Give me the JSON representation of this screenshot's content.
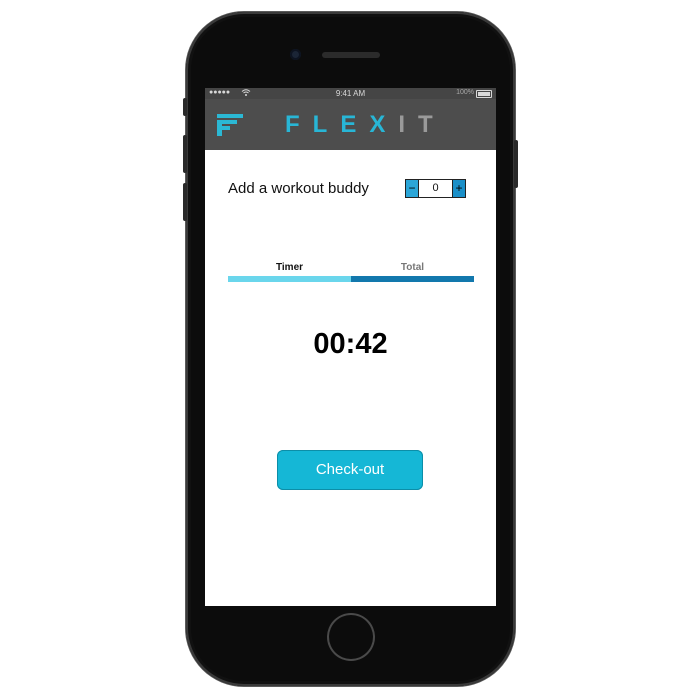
{
  "status_bar": {
    "signal": "●●●●●",
    "wifi_icon": "wifi-icon",
    "time": "9:41 AM",
    "battery_percent": "100%",
    "battery_icon": "battery-icon"
  },
  "app_bar": {
    "brand_main": "FLEX",
    "brand_accent": "IT",
    "menu_icon": "flexit-logo-icon",
    "brand_color": "#28b6d6"
  },
  "buddy": {
    "label": "Add a workout buddy",
    "decrement": "−",
    "value": "0",
    "increment": "+"
  },
  "tabs": [
    {
      "label": "Timer",
      "color": "#6ad6ec"
    },
    {
      "label": "Total",
      "color": "#1278ad"
    }
  ],
  "timer": {
    "display": "00:42"
  },
  "checkout": {
    "label": "Check-out",
    "color": "#15b7d6"
  }
}
